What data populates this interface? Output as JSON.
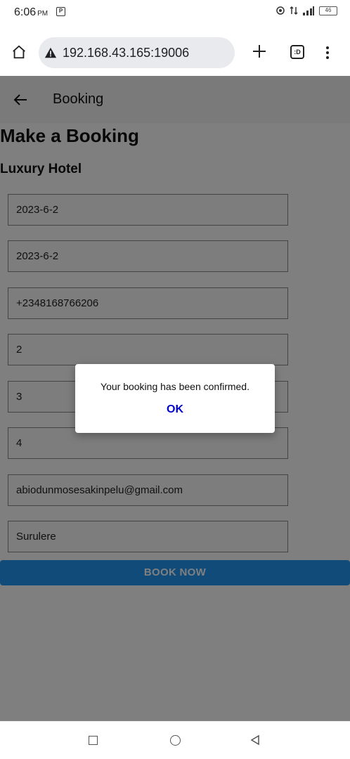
{
  "status_bar": {
    "time": "6:06",
    "ampm": "PM",
    "battery": "46"
  },
  "browser": {
    "url": "192.168.43.165:19006",
    "tab_count": ":D"
  },
  "app": {
    "header_title": "Booking",
    "page_title": "Make a Booking",
    "hotel_name": "Luxury Hotel",
    "fields": [
      "2023-6-2",
      "2023-6-2",
      "+2348168766206",
      "2",
      "3",
      "4",
      "abiodunmosesakinpelu@gmail.com",
      "Surulere"
    ],
    "book_button": "BOOK NOW"
  },
  "dialog": {
    "message": "Your booking has been confirmed.",
    "ok_label": "OK"
  },
  "colors": {
    "accent": "#2196f3",
    "dialog_ok": "#0000cc"
  }
}
